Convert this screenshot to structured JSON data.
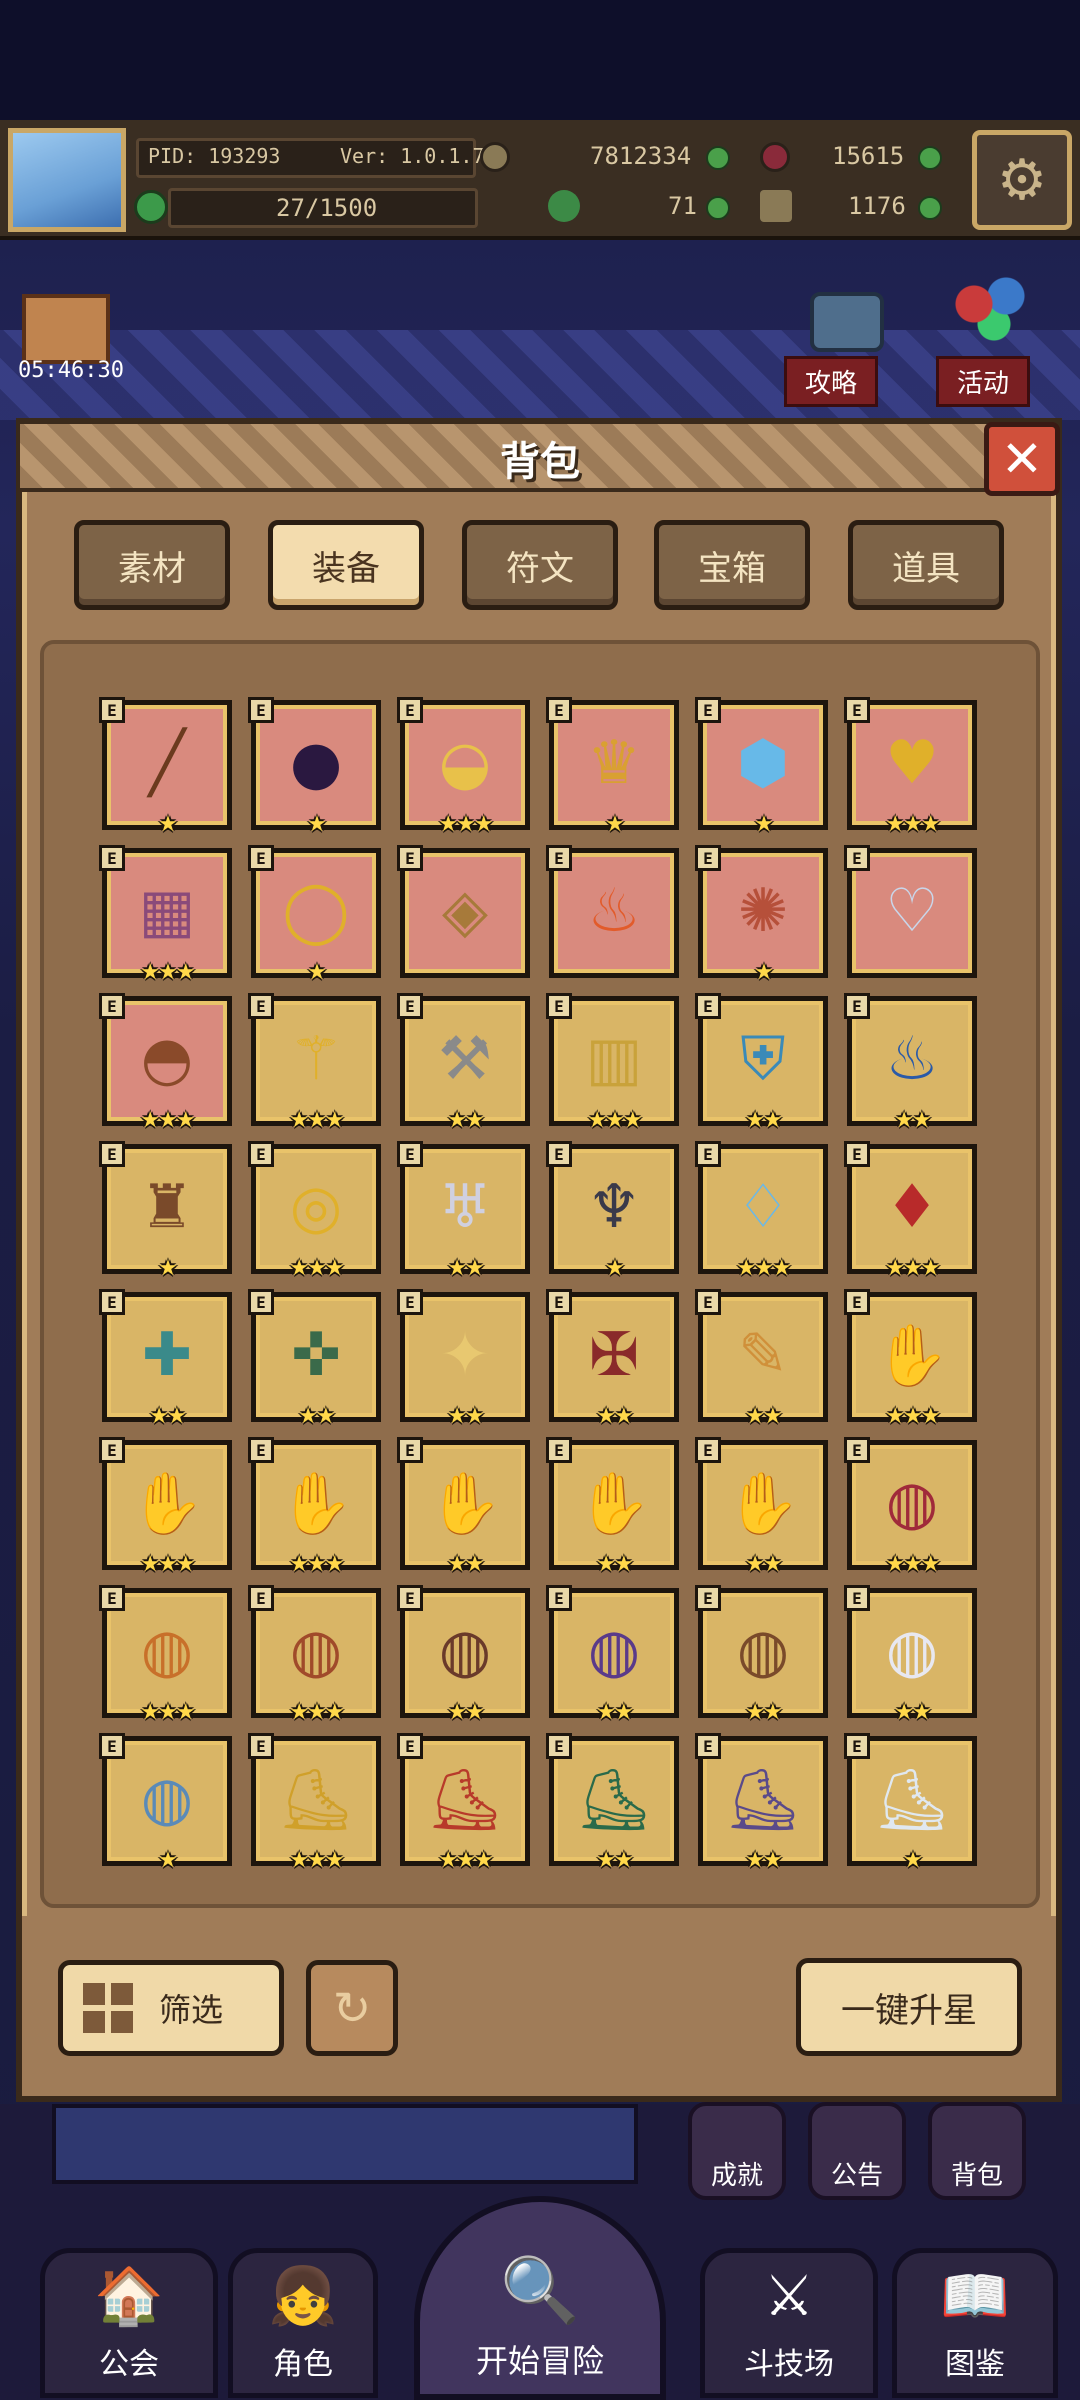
{
  "hud": {
    "pid": "PID: 193293",
    "version": "Ver: 1.0.1.7",
    "gold": "7812334",
    "gems": "15615",
    "stamina": "27/1500",
    "clover": "71",
    "keys": "1176",
    "timer": "05:46:30"
  },
  "side": {
    "guide": "攻略",
    "events": "活动"
  },
  "bag": {
    "title": "背包",
    "tabs": [
      "素材",
      "装备",
      "符文",
      "宝箱",
      "道具"
    ],
    "active_tab": "装备",
    "filter_label": "筛选",
    "upgrade_label": "一键升星",
    "badge": "E"
  },
  "items": [
    {
      "icon": "staff",
      "bg": "red",
      "stars": "★"
    },
    {
      "icon": "dark-orb",
      "bg": "red",
      "stars": "★"
    },
    {
      "icon": "straw-hat",
      "bg": "red",
      "stars": "★★★"
    },
    {
      "icon": "horned-crown",
      "bg": "red",
      "stars": "★"
    },
    {
      "icon": "crystal-helm",
      "bg": "red",
      "stars": "★"
    },
    {
      "icon": "gold-necklace",
      "bg": "red",
      "stars": "★★★"
    },
    {
      "icon": "beaded-necklace",
      "bg": "red",
      "stars": "★★★"
    },
    {
      "icon": "gold-ring",
      "bg": "red",
      "stars": "★"
    },
    {
      "icon": "gem-bracer",
      "bg": "red",
      "stars": ""
    },
    {
      "icon": "fire-ring",
      "bg": "red",
      "stars": ""
    },
    {
      "icon": "tentacle-relic",
      "bg": "red",
      "stars": "★"
    },
    {
      "icon": "silver-necklace",
      "bg": "red",
      "stars": ""
    },
    {
      "icon": "brown-pot",
      "bg": "red",
      "stars": "★★★"
    },
    {
      "icon": "gold-mace",
      "bg": "gold",
      "stars": "★★★"
    },
    {
      "icon": "battle-axe",
      "bg": "gold",
      "stars": "★★"
    },
    {
      "icon": "gold-lantern",
      "bg": "gold",
      "stars": "★★★"
    },
    {
      "icon": "blue-shield",
      "bg": "gold",
      "stars": "★★"
    },
    {
      "icon": "magic-lamp",
      "bg": "gold",
      "stars": "★★"
    },
    {
      "icon": "viking-armor",
      "bg": "gold",
      "stars": "★"
    },
    {
      "icon": "gold-circlet",
      "bg": "gold",
      "stars": "★★★"
    },
    {
      "icon": "winged-helm",
      "bg": "gold",
      "stars": "★★"
    },
    {
      "icon": "demon-helm",
      "bg": "gold",
      "stars": "★"
    },
    {
      "icon": "ice-armor",
      "bg": "gold",
      "stars": "★★★"
    },
    {
      "icon": "red-cape",
      "bg": "gold",
      "stars": "★★★"
    },
    {
      "icon": "teal-armor",
      "bg": "gold",
      "stars": "★★"
    },
    {
      "icon": "green-armor",
      "bg": "gold",
      "stars": "★★"
    },
    {
      "icon": "gold-armor",
      "bg": "gold",
      "stars": "★★"
    },
    {
      "icon": "crimson-armor",
      "bg": "gold",
      "stars": "★★"
    },
    {
      "icon": "gold-scroll",
      "bg": "gold",
      "stars": "★★"
    },
    {
      "icon": "blue-gauntlet",
      "bg": "gold",
      "stars": "★★★"
    },
    {
      "icon": "red-gauntlet",
      "bg": "gold",
      "stars": "★★★"
    },
    {
      "icon": "fox-gauntlet",
      "bg": "gold",
      "stars": "★★★"
    },
    {
      "icon": "bronze-bracer",
      "bg": "gold",
      "stars": "★★"
    },
    {
      "icon": "crystal-gauntlet",
      "bg": "gold",
      "stars": "★★"
    },
    {
      "icon": "demon-gauntlet",
      "bg": "gold",
      "stars": "★★"
    },
    {
      "icon": "ruby-belt",
      "bg": "gold",
      "stars": "★★★"
    },
    {
      "icon": "gold-belt",
      "bg": "gold",
      "stars": "★★★"
    },
    {
      "icon": "ornate-belt",
      "bg": "gold",
      "stars": "★★★"
    },
    {
      "icon": "emerald-belt",
      "bg": "gold",
      "stars": "★★"
    },
    {
      "icon": "purple-belt",
      "bg": "gold",
      "stars": "★★"
    },
    {
      "icon": "leather-belt",
      "bg": "gold",
      "stars": "★★"
    },
    {
      "icon": "white-belt",
      "bg": "gold",
      "stars": "★★"
    },
    {
      "icon": "blue-sash",
      "bg": "gold",
      "stars": "★"
    },
    {
      "icon": "gold-boots",
      "bg": "gold",
      "stars": "★★★"
    },
    {
      "icon": "gold-red-boots",
      "bg": "gold",
      "stars": "★★★"
    },
    {
      "icon": "green-boots",
      "bg": "gold",
      "stars": "★★"
    },
    {
      "icon": "purple-boots",
      "bg": "gold",
      "stars": "★★"
    },
    {
      "icon": "white-boots",
      "bg": "gold",
      "stars": "★"
    }
  ],
  "lower": {
    "achievements": "成就",
    "notice": "公告",
    "bag": "背包",
    "nav": [
      "公会",
      "角色",
      "开始冒险",
      "斗技场",
      "图鉴"
    ]
  },
  "colors": {
    "panel": "#a07c58",
    "cell_red": "#d98a7e",
    "cell_gold": "#d9b566",
    "star": "#ffd84a",
    "close": "#d0503b"
  }
}
